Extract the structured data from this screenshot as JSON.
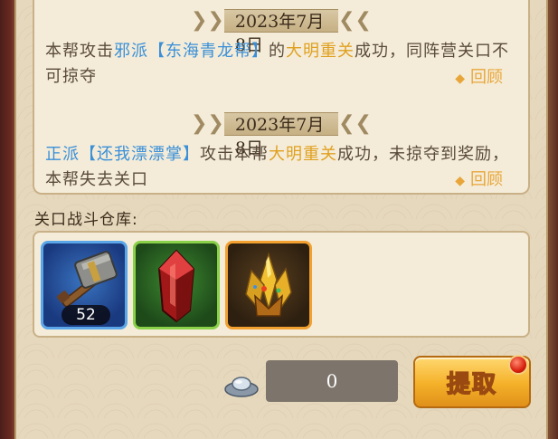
{
  "battle_log": {
    "entries": [
      {
        "date": "2023年7月8日",
        "segments": [
          {
            "text": "本帮攻击",
            "color": "normal"
          },
          {
            "text": "邪派【东海青龙帮】",
            "color": "blue"
          },
          {
            "text": "的",
            "color": "normal"
          },
          {
            "text": "大明重关",
            "color": "gold"
          },
          {
            "text": "成功，同阵营关口不可掠夺",
            "color": "normal"
          }
        ],
        "review_label": "回顾"
      },
      {
        "date": "2023年7月8日",
        "segments": [
          {
            "text": "正派【还我漂漂掌】",
            "color": "blue"
          },
          {
            "text": "攻击本帮",
            "color": "normal"
          },
          {
            "text": "大明重关",
            "color": "gold"
          },
          {
            "text": "成功，未掠夺到奖励，本帮失去关口",
            "color": "normal"
          }
        ],
        "review_label": "回顾"
      }
    ]
  },
  "storage": {
    "label": "关口战斗仓库:",
    "items": [
      {
        "name": "hammer-icon",
        "rarity": "blue",
        "quantity": "52"
      },
      {
        "name": "red-crystal-icon",
        "rarity": "green"
      },
      {
        "name": "gold-crystal-icon",
        "rarity": "orange"
      }
    ]
  },
  "claim": {
    "currency_icon": "silver-ingot-icon",
    "amount": "0",
    "button_label": "提取",
    "has_notification": true
  },
  "colors": {
    "text": "#5a4a3a",
    "highlight_blue": "#3a8fd8",
    "highlight_gold": "#e0a020",
    "link": "#e8a63a"
  }
}
